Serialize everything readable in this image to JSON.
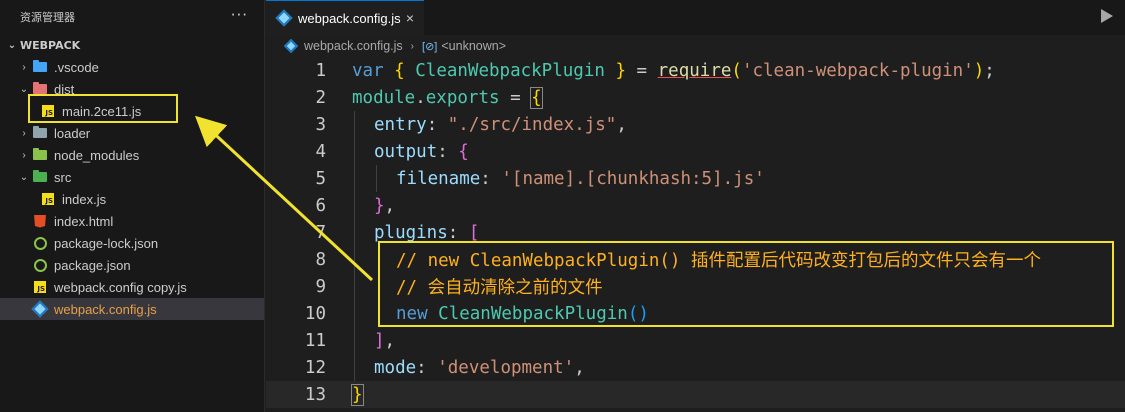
{
  "sidebar": {
    "title": "资源管理器",
    "menu": "···",
    "section": "WEBPACK",
    "items": [
      {
        "label": ".vscode",
        "chev": "›",
        "icon": "folder-vscode-icon"
      },
      {
        "label": "dist",
        "chev": "⌄",
        "icon": "folder-dist-icon"
      },
      {
        "label": "main.2ce11.js",
        "icon": "js-file-icon"
      },
      {
        "label": "loader",
        "chev": "›",
        "icon": "folder-icon"
      },
      {
        "label": "node_modules",
        "chev": "›",
        "icon": "folder-node-icon"
      },
      {
        "label": "src",
        "chev": "⌄",
        "icon": "folder-src-icon"
      },
      {
        "label": "index.js",
        "icon": "js-file-icon"
      },
      {
        "label": "index.html",
        "icon": "html-file-icon"
      },
      {
        "label": "package-lock.json",
        "icon": "json-file-icon"
      },
      {
        "label": "package.json",
        "icon": "json-file-icon"
      },
      {
        "label": "webpack.config copy.js",
        "icon": "js-file-icon"
      },
      {
        "label": "webpack.config.js",
        "icon": "webpack-icon"
      }
    ]
  },
  "editor": {
    "tab_label": "webpack.config.js",
    "tab_close": "×",
    "breadcrumb": {
      "file": "webpack.config.js",
      "symbol_icon": "[⊘]",
      "symbol": "<unknown>"
    },
    "line_numbers": [
      "1",
      "2",
      "3",
      "4",
      "5",
      "6",
      "7",
      "8",
      "9",
      "10",
      "11",
      "12",
      "13"
    ],
    "code": {
      "l1": {
        "var": "var",
        "ob": "{",
        "name": "CleanWebpackPlugin",
        "cb": "}",
        "eq": "=",
        "req": "require",
        "op": "(",
        "str": "'clean-webpack-plugin'",
        "cp": ")",
        "semi": ";"
      },
      "l2": {
        "mod": "module",
        "dot": ".",
        "exp": "exports",
        "eq": " = ",
        "ob": "{"
      },
      "l3": {
        "key": "entry",
        "colon": ": ",
        "val": "\"./src/index.js\"",
        "comma": ","
      },
      "l4": {
        "key": "output",
        "colon": ": ",
        "ob": "{"
      },
      "l5": {
        "key": "filename",
        "colon": ": ",
        "val": "'[name].[chunkhash:5].js'"
      },
      "l6": {
        "cb": "}",
        "comma": ","
      },
      "l7": {
        "key": "plugins",
        "colon": ": ",
        "ob": "["
      },
      "l8": {
        "comment": "// new CleanWebpackPlugin() 插件配置后代码改变打包后的文件只会有一个"
      },
      "l9": {
        "comment": "// 会自动清除之前的文件"
      },
      "l10": {
        "new": "new",
        "cls": "CleanWebpackPlugin",
        "par": "()"
      },
      "l11": {
        "cb": "]",
        "comma": ","
      },
      "l12": {
        "key": "mode",
        "colon": ": ",
        "val": "'development'",
        "comma": ","
      },
      "l13": {
        "cb": "}"
      }
    }
  },
  "colors": {
    "highlight_box": "#f2e230",
    "arrow": "#f2e230",
    "selected_file": "#e8a047"
  }
}
